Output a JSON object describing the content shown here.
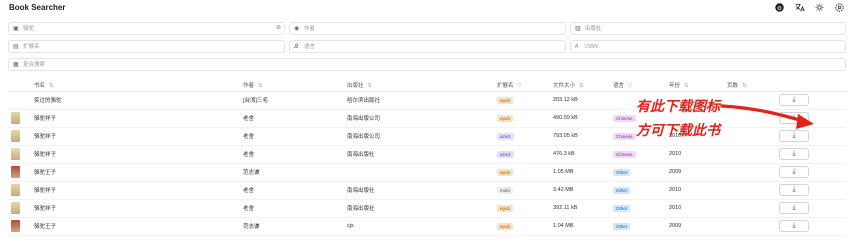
{
  "app_title": "Book Searcher",
  "header_icons": [
    "github-icon",
    "translate-icon",
    "sun-icon",
    "settings-icon"
  ],
  "filters": {
    "title": {
      "placeholder": "书名",
      "icon": "book-icon",
      "value": "骆驼",
      "clear": "⊗"
    },
    "author": {
      "placeholder": "作者",
      "icon": "user-icon"
    },
    "publisher": {
      "placeholder": "出版社",
      "icon": "building-icon"
    },
    "extension": {
      "placeholder": "扩展名",
      "icon": "file-icon"
    },
    "language": {
      "placeholder": "语言",
      "icon": "language-icon"
    },
    "isbn": {
      "placeholder": "ISBN",
      "icon": "hash-icon"
    },
    "combined": {
      "placeholder": "复合搜索",
      "icon": "search-icon"
    }
  },
  "columns": [
    "书名",
    "作者",
    "出版社",
    "扩展名",
    "文件大小",
    "语言",
    "年份",
    "页数"
  ],
  "rows": [
    {
      "cover": "",
      "title": "笑过的骆驼",
      "author": "[台湾]三毛",
      "publisher": "哈尔滨出版社",
      "ext": "epub",
      "size": "203.12 kB",
      "lang": "",
      "year": "",
      "pages": ""
    },
    {
      "cover": "#e8d4a8",
      "title": "骆驼祥子",
      "author": "老舍",
      "publisher": "南海出版公司",
      "ext": "epub",
      "size": "490.59 kB",
      "lang": "Chinese",
      "year": "",
      "pages": ""
    },
    {
      "cover": "#e8d4a8",
      "title": "骆驼祥子",
      "author": "老舍",
      "publisher": "南海出版公司",
      "ext": "azw3",
      "size": "793.05 kB",
      "lang": "Chinese",
      "year": "2010",
      "pages": ""
    },
    {
      "cover": "#eed9b3",
      "title": "骆驼祥子",
      "author": "老舍",
      "publisher": "南海出版社",
      "ext": "azw3",
      "size": "476.3 kB",
      "lang": "Chinese",
      "year": "2010",
      "pages": ""
    },
    {
      "cover": "#b8463a",
      "title": "骆驼王子",
      "author": "范志谦",
      "publisher": "",
      "ext": "epub",
      "size": "1.05 MB",
      "lang": "Other",
      "year": "2009",
      "pages": ""
    },
    {
      "cover": "#e8d4a8",
      "title": "骆驼祥子",
      "author": "老舍",
      "publisher": "南海出版社",
      "ext": "mobi",
      "size": "3.42 MB",
      "lang": "Other",
      "year": "2010",
      "pages": ""
    },
    {
      "cover": "#e8d4a8",
      "title": "骆驼祥子",
      "author": "老舍",
      "publisher": "南海出版社",
      "ext": "epub",
      "size": "392.11 kB",
      "lang": "Other",
      "year": "2010",
      "pages": ""
    },
    {
      "cover": "#b8463a",
      "title": "骆驼王子",
      "author": "范志谦",
      "publisher": "cjs",
      "ext": "epub",
      "size": "1.04 MB",
      "lang": "Other",
      "year": "2009",
      "pages": ""
    }
  ],
  "download_label": "⤓",
  "annotation": {
    "line1": "有此下载图标",
    "line2": "方可下载此书",
    "color": "#e2231a"
  }
}
